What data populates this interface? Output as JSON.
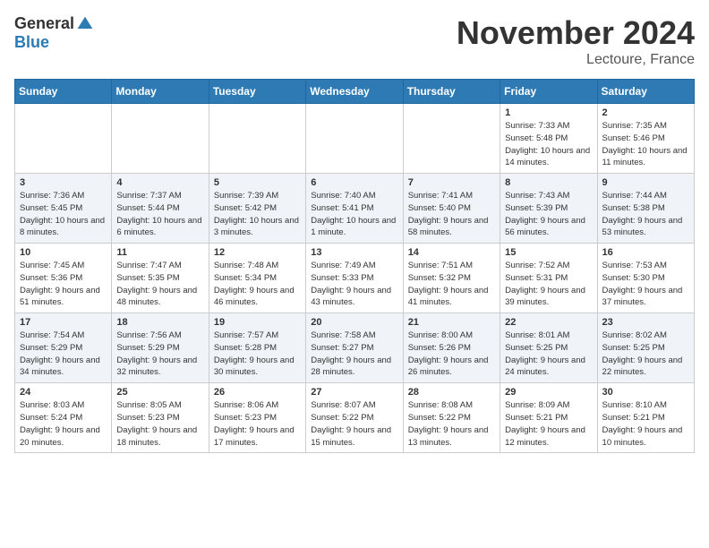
{
  "header": {
    "logo_general": "General",
    "logo_blue": "Blue",
    "month": "November 2024",
    "location": "Lectoure, France"
  },
  "weekdays": [
    "Sunday",
    "Monday",
    "Tuesday",
    "Wednesday",
    "Thursday",
    "Friday",
    "Saturday"
  ],
  "weeks": [
    [
      {
        "day": "",
        "info": ""
      },
      {
        "day": "",
        "info": ""
      },
      {
        "day": "",
        "info": ""
      },
      {
        "day": "",
        "info": ""
      },
      {
        "day": "",
        "info": ""
      },
      {
        "day": "1",
        "info": "Sunrise: 7:33 AM\nSunset: 5:48 PM\nDaylight: 10 hours and 14 minutes."
      },
      {
        "day": "2",
        "info": "Sunrise: 7:35 AM\nSunset: 5:46 PM\nDaylight: 10 hours and 11 minutes."
      }
    ],
    [
      {
        "day": "3",
        "info": "Sunrise: 7:36 AM\nSunset: 5:45 PM\nDaylight: 10 hours and 8 minutes."
      },
      {
        "day": "4",
        "info": "Sunrise: 7:37 AM\nSunset: 5:44 PM\nDaylight: 10 hours and 6 minutes."
      },
      {
        "day": "5",
        "info": "Sunrise: 7:39 AM\nSunset: 5:42 PM\nDaylight: 10 hours and 3 minutes."
      },
      {
        "day": "6",
        "info": "Sunrise: 7:40 AM\nSunset: 5:41 PM\nDaylight: 10 hours and 1 minute."
      },
      {
        "day": "7",
        "info": "Sunrise: 7:41 AM\nSunset: 5:40 PM\nDaylight: 9 hours and 58 minutes."
      },
      {
        "day": "8",
        "info": "Sunrise: 7:43 AM\nSunset: 5:39 PM\nDaylight: 9 hours and 56 minutes."
      },
      {
        "day": "9",
        "info": "Sunrise: 7:44 AM\nSunset: 5:38 PM\nDaylight: 9 hours and 53 minutes."
      }
    ],
    [
      {
        "day": "10",
        "info": "Sunrise: 7:45 AM\nSunset: 5:36 PM\nDaylight: 9 hours and 51 minutes."
      },
      {
        "day": "11",
        "info": "Sunrise: 7:47 AM\nSunset: 5:35 PM\nDaylight: 9 hours and 48 minutes."
      },
      {
        "day": "12",
        "info": "Sunrise: 7:48 AM\nSunset: 5:34 PM\nDaylight: 9 hours and 46 minutes."
      },
      {
        "day": "13",
        "info": "Sunrise: 7:49 AM\nSunset: 5:33 PM\nDaylight: 9 hours and 43 minutes."
      },
      {
        "day": "14",
        "info": "Sunrise: 7:51 AM\nSunset: 5:32 PM\nDaylight: 9 hours and 41 minutes."
      },
      {
        "day": "15",
        "info": "Sunrise: 7:52 AM\nSunset: 5:31 PM\nDaylight: 9 hours and 39 minutes."
      },
      {
        "day": "16",
        "info": "Sunrise: 7:53 AM\nSunset: 5:30 PM\nDaylight: 9 hours and 37 minutes."
      }
    ],
    [
      {
        "day": "17",
        "info": "Sunrise: 7:54 AM\nSunset: 5:29 PM\nDaylight: 9 hours and 34 minutes."
      },
      {
        "day": "18",
        "info": "Sunrise: 7:56 AM\nSunset: 5:29 PM\nDaylight: 9 hours and 32 minutes."
      },
      {
        "day": "19",
        "info": "Sunrise: 7:57 AM\nSunset: 5:28 PM\nDaylight: 9 hours and 30 minutes."
      },
      {
        "day": "20",
        "info": "Sunrise: 7:58 AM\nSunset: 5:27 PM\nDaylight: 9 hours and 28 minutes."
      },
      {
        "day": "21",
        "info": "Sunrise: 8:00 AM\nSunset: 5:26 PM\nDaylight: 9 hours and 26 minutes."
      },
      {
        "day": "22",
        "info": "Sunrise: 8:01 AM\nSunset: 5:25 PM\nDaylight: 9 hours and 24 minutes."
      },
      {
        "day": "23",
        "info": "Sunrise: 8:02 AM\nSunset: 5:25 PM\nDaylight: 9 hours and 22 minutes."
      }
    ],
    [
      {
        "day": "24",
        "info": "Sunrise: 8:03 AM\nSunset: 5:24 PM\nDaylight: 9 hours and 20 minutes."
      },
      {
        "day": "25",
        "info": "Sunrise: 8:05 AM\nSunset: 5:23 PM\nDaylight: 9 hours and 18 minutes."
      },
      {
        "day": "26",
        "info": "Sunrise: 8:06 AM\nSunset: 5:23 PM\nDaylight: 9 hours and 17 minutes."
      },
      {
        "day": "27",
        "info": "Sunrise: 8:07 AM\nSunset: 5:22 PM\nDaylight: 9 hours and 15 minutes."
      },
      {
        "day": "28",
        "info": "Sunrise: 8:08 AM\nSunset: 5:22 PM\nDaylight: 9 hours and 13 minutes."
      },
      {
        "day": "29",
        "info": "Sunrise: 8:09 AM\nSunset: 5:21 PM\nDaylight: 9 hours and 12 minutes."
      },
      {
        "day": "30",
        "info": "Sunrise: 8:10 AM\nSunset: 5:21 PM\nDaylight: 9 hours and 10 minutes."
      }
    ]
  ]
}
